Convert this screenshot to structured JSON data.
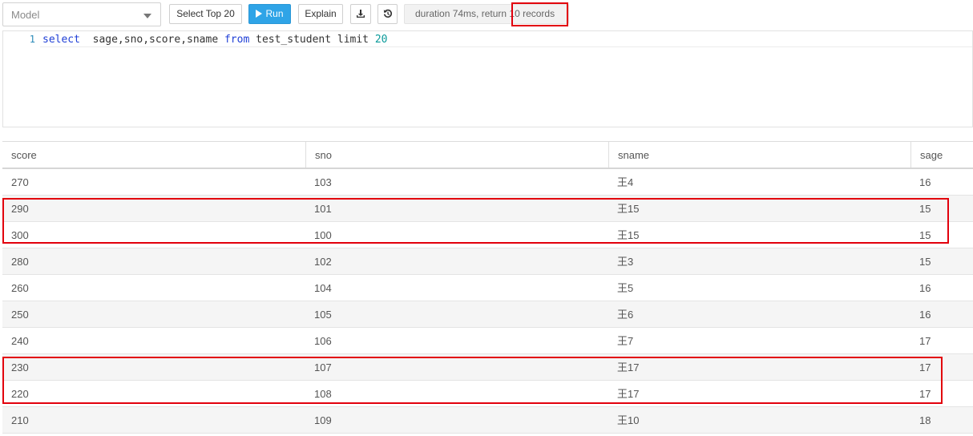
{
  "toolbar": {
    "model_select": "Model",
    "select_top_label": "Select Top 20",
    "run_label": "Run",
    "explain_label": "Explain",
    "status_text": "duration 74ms, return 10 records"
  },
  "editor": {
    "line_number": "1",
    "code_parts": {
      "kw1": "select",
      "cols": "  sage,sno,score,sname ",
      "kw2": "from",
      "table": " test_student limit ",
      "limit": "20"
    }
  },
  "grid": {
    "columns": [
      "score",
      "sno",
      "sname",
      "sage"
    ],
    "rows": [
      [
        "270",
        "103",
        "王4",
        "16"
      ],
      [
        "290",
        "101",
        "王15",
        "15"
      ],
      [
        "300",
        "100",
        "王15",
        "15"
      ],
      [
        "280",
        "102",
        "王3",
        "15"
      ],
      [
        "260",
        "104",
        "王5",
        "16"
      ],
      [
        "250",
        "105",
        "王6",
        "16"
      ],
      [
        "240",
        "106",
        "王7",
        "17"
      ],
      [
        "230",
        "107",
        "王17",
        "17"
      ],
      [
        "220",
        "108",
        "王17",
        "17"
      ],
      [
        "210",
        "109",
        "王10",
        "18"
      ]
    ]
  },
  "colors": {
    "run_button": "#2fa4e7",
    "highlight": "#e2000c"
  },
  "icons": [
    "chevron-down-icon",
    "play-icon",
    "download-icon",
    "history-icon"
  ]
}
